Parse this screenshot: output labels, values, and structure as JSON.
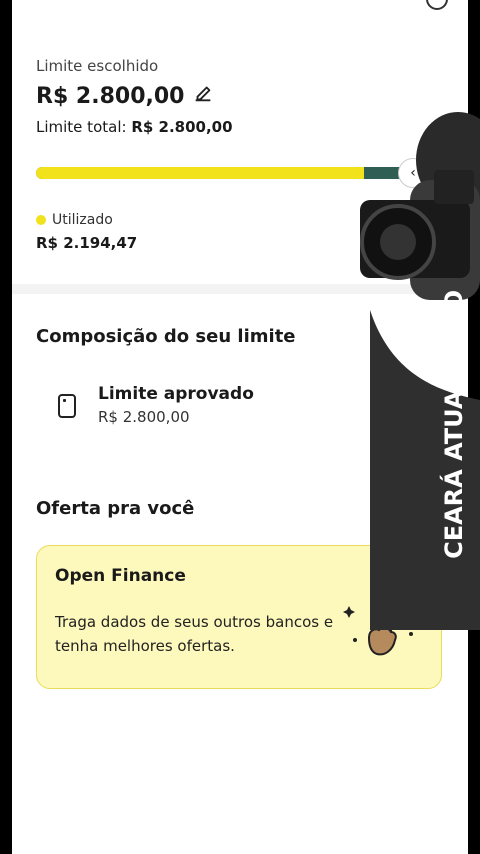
{
  "limit": {
    "chosen_label": "Limite escolhido",
    "chosen_value": "R$ 2.800,00",
    "total_label": "Limite total:",
    "total_value": "R$ 2.800,00",
    "used_fraction": 0.78,
    "used_legend": "Utilizado",
    "used_value": "R$ 2.194,47"
  },
  "composition": {
    "title": "Composição do seu limite",
    "item_title": "Limite aprovado",
    "item_value": "R$ 2.800,00"
  },
  "offer": {
    "section_title": "Oferta pra você",
    "card_title": "Open Finance",
    "card_text": "Traga dados de seus outros bancos e tenha melhores ofertas."
  },
  "overlay": {
    "watermark_text": "CEARÁ ATUALIZADO"
  },
  "colors": {
    "accent": "#f2e21b",
    "bar_remaining": "#2f5e55",
    "offer_bg": "#fdf8bb"
  }
}
